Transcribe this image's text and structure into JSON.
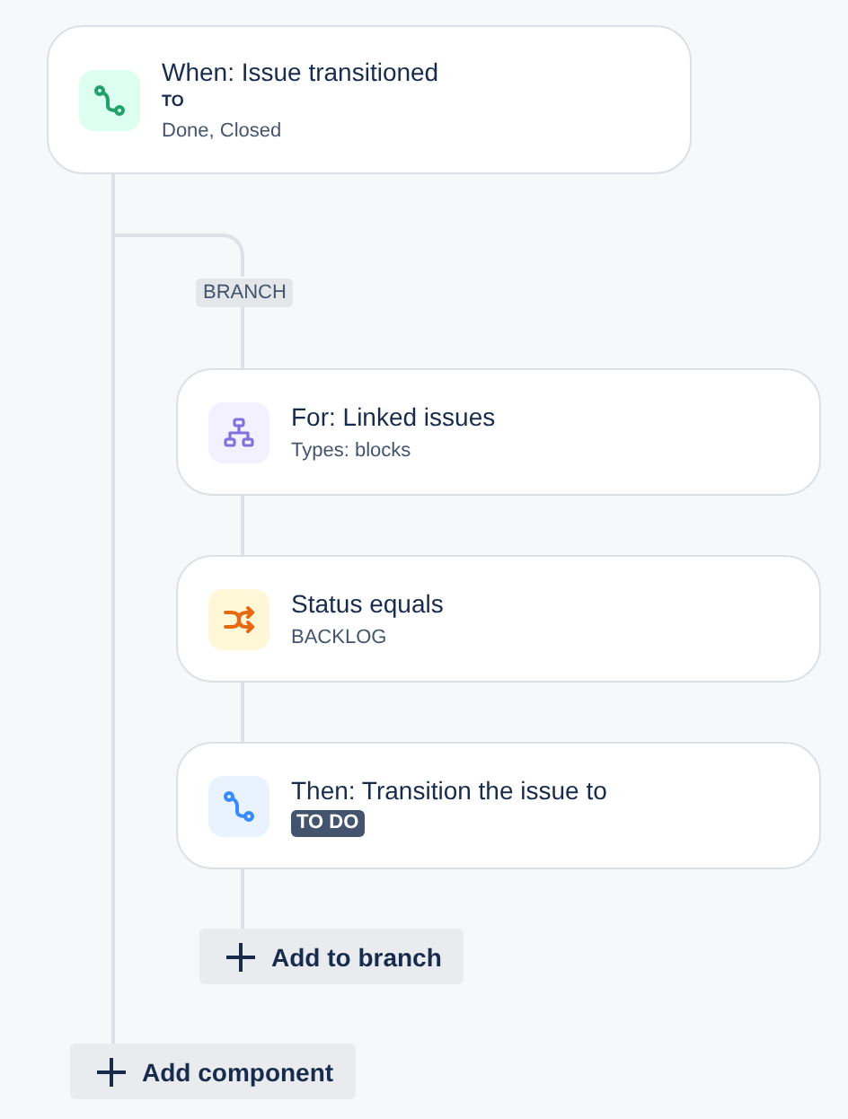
{
  "trigger": {
    "kind": "transition",
    "title": "When: Issue transitioned",
    "label": "TO",
    "detail": "Done, Closed"
  },
  "branch": {
    "label": "BRANCH",
    "nodes": [
      {
        "kind": "hierarchy",
        "title": "For: Linked issues",
        "detail": "Types: blocks"
      },
      {
        "kind": "shuffle",
        "title": "Status equals",
        "detail": "BACKLOG"
      },
      {
        "kind": "action",
        "title": "Then: Transition the issue to",
        "lozenge": "TO DO"
      }
    ],
    "add_button": "Add to branch"
  },
  "add_component": "Add component"
}
